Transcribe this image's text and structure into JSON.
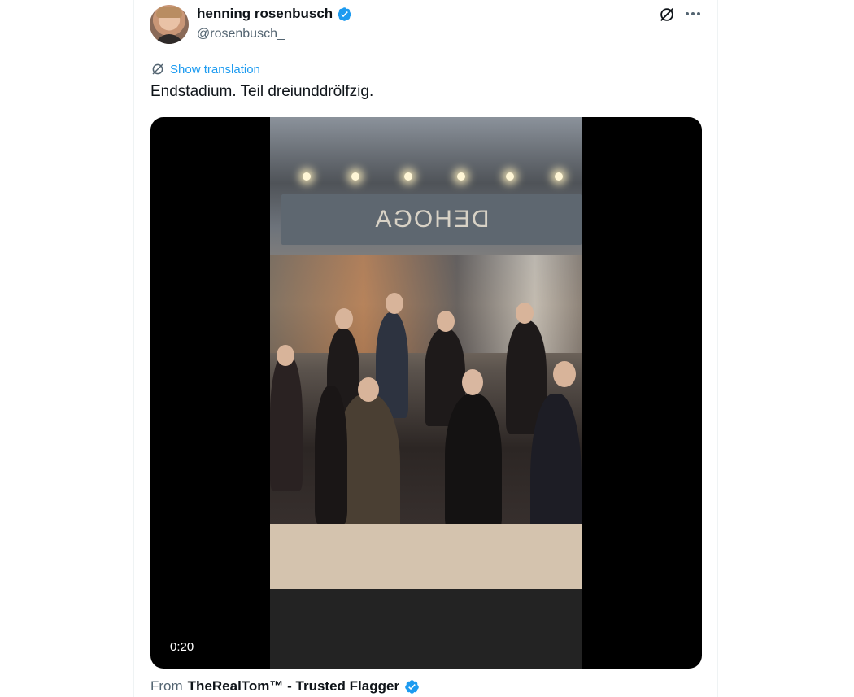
{
  "author": {
    "name": "henning rosenbusch",
    "handle": "@rosenbusch_",
    "verified_color": "#1d9bf0"
  },
  "header_icons": [
    "grok-icon",
    "more-icon"
  ],
  "tweet": {
    "show_translation": "Show translation",
    "text": "Endstadium. Teil dreiunddrölfzig."
  },
  "media": {
    "duration": "0:20",
    "banner_text": "DEHOGA"
  },
  "from": {
    "label": "From",
    "source": "TheRealTom™ - Trusted Flagger"
  }
}
